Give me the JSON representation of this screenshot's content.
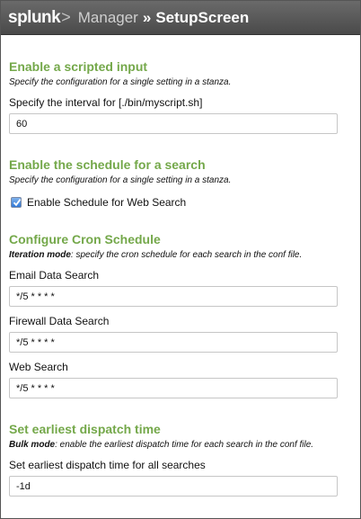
{
  "header": {
    "logo_text": "splunk",
    "logo_chevron": ">",
    "breadcrumb_manager": "Manager",
    "breadcrumb_separator": "»",
    "page_title": "SetupScreen"
  },
  "sections": {
    "scripted_input": {
      "title": "Enable a scripted input",
      "description": "Specify the configuration for a single setting in a stanza.",
      "field_label": "Specify the interval for [./bin/myscript.sh]",
      "field_value": "60"
    },
    "schedule": {
      "title": "Enable the schedule for a search",
      "description": "Specify the configuration for a single setting in a stanza.",
      "checkbox_label": "Enable Schedule for Web Search",
      "checkbox_checked": true
    },
    "cron": {
      "title": "Configure Cron Schedule",
      "mode_label": "Iteration mode",
      "mode_description": ": specify the cron schedule for each search in the conf file.",
      "fields": [
        {
          "label": "Email Data Search",
          "value": "*/5 * * * *"
        },
        {
          "label": "Firewall Data Search",
          "value": "*/5 * * * *"
        },
        {
          "label": "Web Search",
          "value": "*/5 * * * *"
        }
      ]
    },
    "dispatch": {
      "title": "Set earliest dispatch time",
      "mode_label": "Bulk mode",
      "mode_description": ": enable the earliest dispatch time for each search in the conf file.",
      "field_label": "Set earliest dispatch time for all searches",
      "field_value": "-1d"
    }
  }
}
